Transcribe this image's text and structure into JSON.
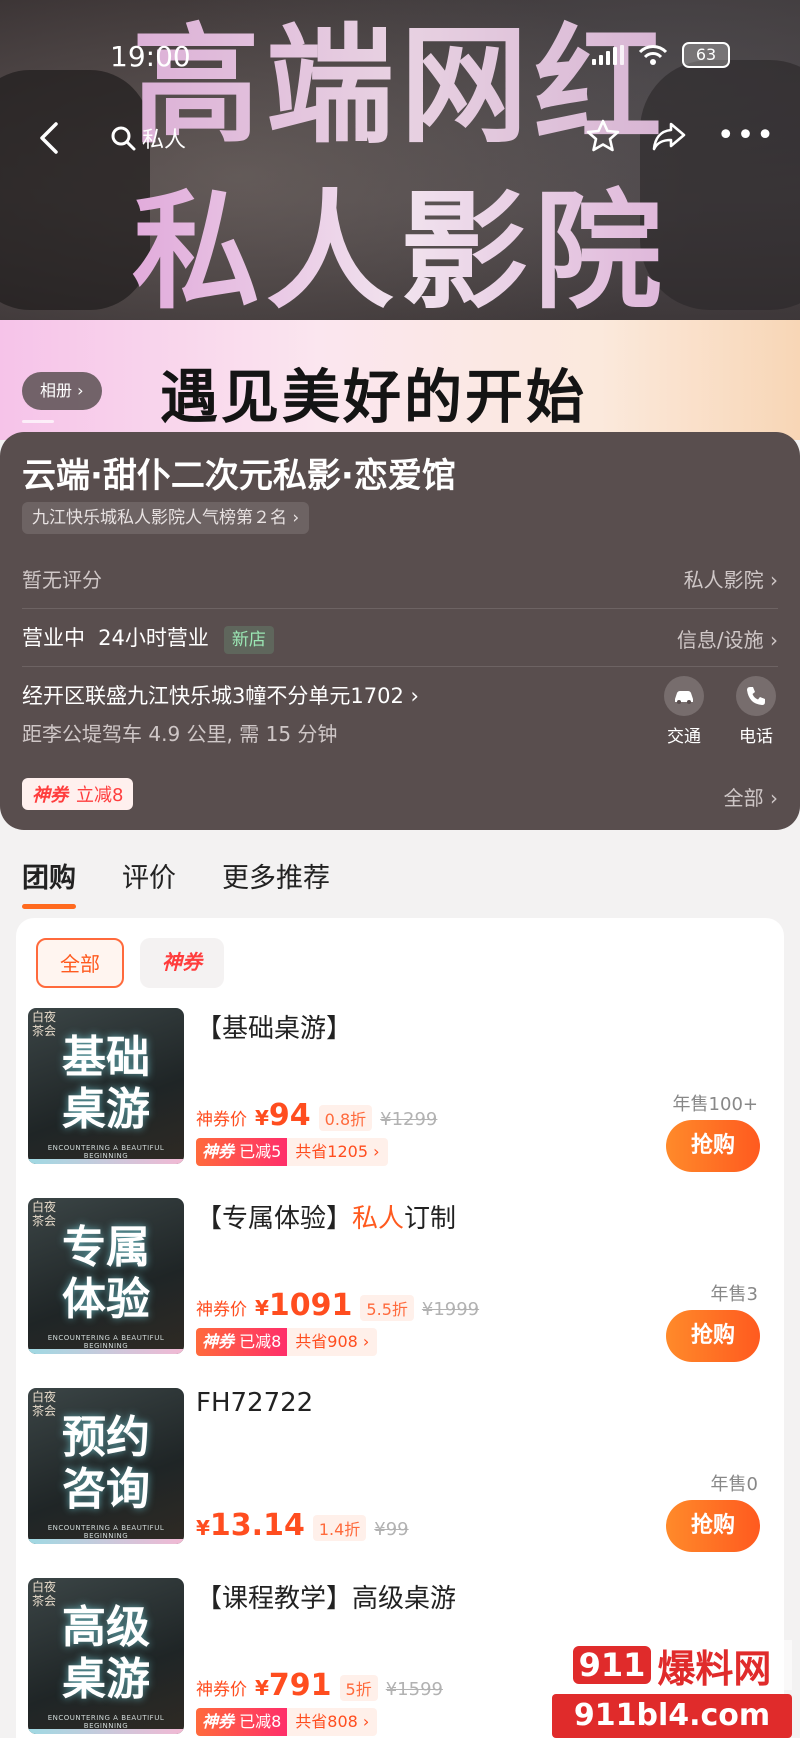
{
  "status_bar": {
    "time": "19:00",
    "battery": "63"
  },
  "nav": {
    "search_text": "私人"
  },
  "hero": {
    "headline_1": "高端网红",
    "headline_2": "私人影院",
    "slogan": "遇见美好的开始",
    "album_button": "相册 ›"
  },
  "shop": {
    "name": "云端·甜仆二次元私影·恋爱馆",
    "rank_tag": "九江快乐城私人影院人气榜第２名 ›",
    "rating_text": "暂无评分",
    "category_link": "私人影院 ›",
    "hours_status": "营业中",
    "hours_text": "24小时营业",
    "new_tag": "新店",
    "facilities_link": "信息/设施 ›",
    "address": "经开区联盛九江快乐城3幢不分单元1702 ›",
    "distance": "距李公堤驾车 4.9 公里, 需 15 分钟",
    "traffic_label": "交通",
    "phone_label": "电话",
    "coupon_brand": "神券",
    "coupon_offer": "立减8",
    "all_link": "全部 ›"
  },
  "tabs": [
    {
      "label": "团购",
      "active": true
    },
    {
      "label": "评价",
      "active": false
    },
    {
      "label": "更多推荐",
      "active": false
    }
  ],
  "filters": {
    "all": "全部",
    "coupon": "神券"
  },
  "deals": [
    {
      "thumb_corner": "白夜\n茶会",
      "thumb_line1": "基础",
      "thumb_line2": "桌游",
      "thumb_footer": "ENCOUNTERING A BEAUTIFUL BEGINNING",
      "title": "【基础桌游】",
      "title_highlight": "",
      "title_suffix": "",
      "price_prefix": "神券价",
      "price": "94",
      "discount": "0.8折",
      "original": "¥1299",
      "save_brand": "神券",
      "save_amount": "已减5",
      "save_total": "共省1205 ›",
      "sold": "年售100+",
      "buy": "抢购"
    },
    {
      "thumb_corner": "白夜\n茶会",
      "thumb_line1": "专属",
      "thumb_line2": "体验",
      "thumb_footer": "ENCOUNTERING A BEAUTIFUL BEGINNING",
      "title": "【专属体验】",
      "title_highlight": "私人",
      "title_suffix": "订制",
      "price_prefix": "神券价",
      "price": "1091",
      "discount": "5.5折",
      "original": "¥1999",
      "save_brand": "神券",
      "save_amount": "已减8",
      "save_total": "共省908 ›",
      "sold": "年售3",
      "buy": "抢购"
    },
    {
      "thumb_corner": "白夜\n茶会",
      "thumb_line1": "预约",
      "thumb_line2": "咨询",
      "thumb_footer": "ENCOUNTERING A BEAUTIFUL BEGINNING",
      "title": "FH72722",
      "title_highlight": "",
      "title_suffix": "",
      "price_prefix": "",
      "price": "13.14",
      "discount": "1.4折",
      "original": "¥99",
      "save_brand": "",
      "save_amount": "",
      "save_total": "",
      "sold": "年售0",
      "buy": "抢购"
    },
    {
      "thumb_corner": "白夜\n茶会",
      "thumb_line1": "高级",
      "thumb_line2": "桌游",
      "thumb_footer": "ENCOUNTERING A BEAUTIFUL BEGINNING",
      "title": "【课程教学】高级桌游",
      "title_highlight": "",
      "title_suffix": "",
      "price_prefix": "神券价",
      "price": "791",
      "discount": "5折",
      "original": "¥1599",
      "save_brand": "神券",
      "save_amount": "已减8",
      "save_total": "共省808 ›",
      "sold": "",
      "buy": "抢购"
    }
  ],
  "watermark": {
    "top_num": "911",
    "top_text": "爆料网",
    "domain": "911bl4.com"
  },
  "colors": {
    "accent": "#ff5a1f",
    "card_bg": "#594e4e",
    "coupon_red": "#ff3d3d"
  }
}
